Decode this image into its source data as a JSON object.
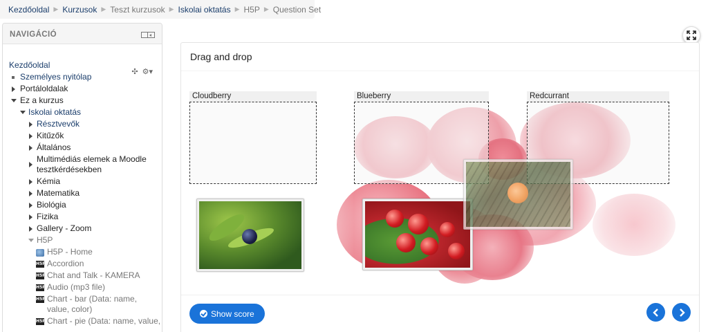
{
  "breadcrumb": {
    "items": [
      "Kezdőoldal",
      "Kurzusok",
      "Teszt kurzusok",
      "Iskolai oktatás",
      "H5P",
      "Question Set"
    ]
  },
  "nav": {
    "title": "NAVIGÁCIÓ",
    "items": [
      {
        "label": "Kezdőoldal"
      },
      {
        "label": "Személyes nyitólap"
      },
      {
        "label": "Portáloldalak"
      },
      {
        "label": "Ez a kurzus"
      },
      {
        "label": "Iskolai oktatás"
      },
      {
        "label": "Résztvevők"
      },
      {
        "label": "Kitűzők"
      },
      {
        "label": "Általános"
      },
      {
        "label": "Multimédiás elemek a Moodle tesztkérdésekben"
      },
      {
        "label": "Kémia"
      },
      {
        "label": "Matematika"
      },
      {
        "label": "Biológia"
      },
      {
        "label": "Fizika"
      },
      {
        "label": "Gallery - Zoom"
      },
      {
        "label": "H5P"
      },
      {
        "label": "H5P - Home"
      },
      {
        "label": "Accordion"
      },
      {
        "label": "Chat and Talk - KAMERA"
      },
      {
        "label": "Audio (mp3 file)"
      },
      {
        "label": "Chart - bar (Data: name, value, color)"
      },
      {
        "label": "Chart - pie (Data: name, value,"
      }
    ]
  },
  "h5p": {
    "title": "Drag and drop",
    "dropzones": [
      "Cloudberry",
      "Blueberry",
      "Redcurrant"
    ],
    "draggables": [
      "blueberry",
      "redcurrant",
      "cloudberry"
    ],
    "show_score": "Show score"
  },
  "colors": {
    "link": "#1a3d6b",
    "accent": "#1a73d9",
    "berry": "#e8707e"
  }
}
